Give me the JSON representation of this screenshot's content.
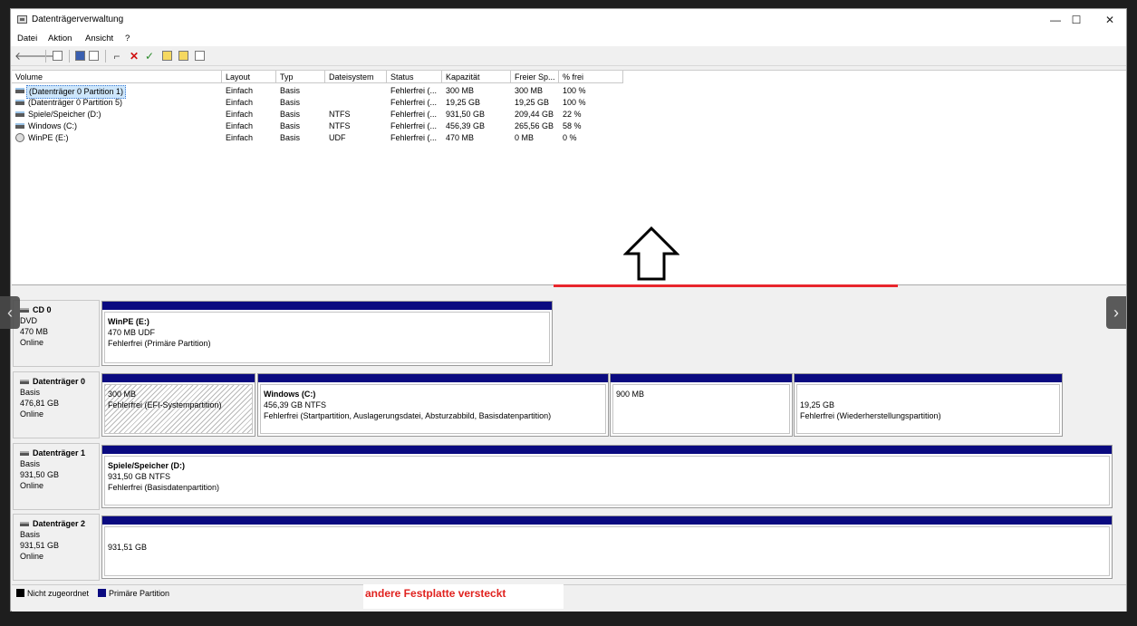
{
  "window": {
    "title": "Datenträgerverwaltung",
    "minimize_glyph": "—",
    "maximize_glyph": "☐",
    "close_glyph": "✕"
  },
  "menu": [
    "Datei",
    "Aktion",
    "Ansicht",
    "?"
  ],
  "listview": {
    "columns": [
      "Volume",
      "Layout",
      "Typ",
      "Dateisystem",
      "Status",
      "Kapazität",
      "Freier Sp...",
      "% frei"
    ],
    "rows": [
      {
        "volume": "(Datenträger 0 Partition 1)",
        "layout": "Einfach",
        "typ": "Basis",
        "fs": "",
        "status": "Fehlerfrei (...",
        "cap": "300 MB",
        "free": "300 MB",
        "pct": "100 %",
        "icon": "disk"
      },
      {
        "volume": "(Datenträger 0 Partition 5)",
        "layout": "Einfach",
        "typ": "Basis",
        "fs": "",
        "status": "Fehlerfrei (...",
        "cap": "19,25 GB",
        "free": "19,25 GB",
        "pct": "100 %",
        "icon": "disk"
      },
      {
        "volume": "Spiele/Speicher (D:)",
        "layout": "Einfach",
        "typ": "Basis",
        "fs": "NTFS",
        "status": "Fehlerfrei (...",
        "cap": "931,50 GB",
        "free": "209,44 GB",
        "pct": "22 %",
        "icon": "disk"
      },
      {
        "volume": "Windows (C:)",
        "layout": "Einfach",
        "typ": "Basis",
        "fs": "NTFS",
        "status": "Fehlerfrei (...",
        "cap": "456,39 GB",
        "free": "265,56 GB",
        "pct": "58 %",
        "icon": "disk"
      },
      {
        "volume": "WinPE (E:)",
        "layout": "Einfach",
        "typ": "Basis",
        "fs": "UDF",
        "status": "Fehlerfrei (...",
        "cap": "470 MB",
        "free": "0 MB",
        "pct": "0 %",
        "icon": "cd"
      }
    ]
  },
  "disks": [
    {
      "name": "CD 0",
      "type": "DVD",
      "size": "470 MB",
      "state": "Online",
      "partitions": [
        {
          "name": "WinPE  (E:)",
          "size": "470 MB UDF",
          "status": "Fehlerfrei (Primäre Partition)"
        }
      ]
    },
    {
      "name": "Datenträger 0",
      "type": "Basis",
      "size": "476,81 GB",
      "state": "Online",
      "partitions": [
        {
          "name": "",
          "size": "300 MB",
          "status": "Fehlerfrei (EFI-Systempartition)"
        },
        {
          "name": "Windows  (C:)",
          "size": "456,39 GB NTFS",
          "status": "Fehlerfrei (Startpartition, Auslagerungsdatei, Absturzabbild, Basisdatenpartition)"
        },
        {
          "name": "",
          "size": "900 MB",
          "status": ""
        },
        {
          "name": "",
          "size": "19,25 GB",
          "status": "Fehlerfrei (Wiederherstellungspartition)"
        }
      ]
    },
    {
      "name": "Datenträger 1",
      "type": "Basis",
      "size": "931,50 GB",
      "state": "Online",
      "partitions": [
        {
          "name": "Spiele/Speicher  (D:)",
          "size": "931,50 GB NTFS",
          "status": "Fehlerfrei (Basisdatenpartition)"
        }
      ]
    },
    {
      "name": "Datenträger 2",
      "type": "Basis",
      "size": "931,51 GB",
      "state": "Online",
      "partitions": [
        {
          "name": "",
          "size": "931,51 GB",
          "status": ""
        }
      ]
    }
  ],
  "legend": {
    "unallocated": "Nicht zugeordnet",
    "primary": "Primäre Partition"
  },
  "annotation": {
    "note": "andere Festplatte versteckt"
  },
  "colors": {
    "primary_bar": "#0a0a80",
    "annotation_red": "#e8262c",
    "selection": "#cde6fb"
  },
  "nav": {
    "prev": "‹",
    "next": "›"
  }
}
